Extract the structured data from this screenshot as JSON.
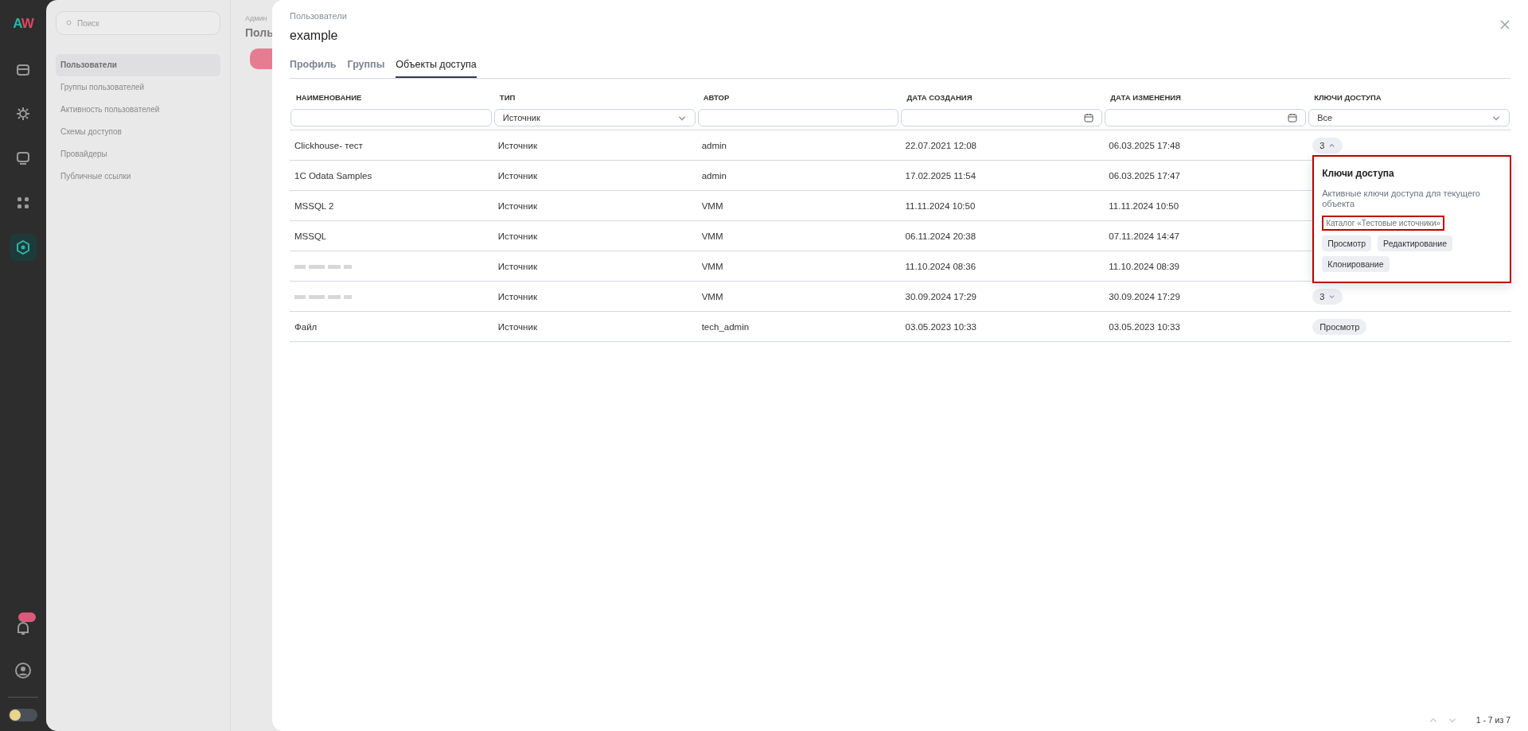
{
  "rail": {
    "logo": [
      {
        "text": "A",
        "color": "#2bb5a8"
      },
      {
        "text": "W",
        "color": "#e0455e"
      }
    ],
    "items": [
      {
        "selected": false
      },
      {
        "selected": false
      },
      {
        "selected": false
      },
      {
        "selected": false
      },
      {
        "selected": true
      }
    ],
    "theme_toggle": {
      "on": false
    }
  },
  "nav": {
    "search": {
      "placeholder": "Поиск"
    },
    "items": [
      {
        "label": "Пользователи",
        "selected": true
      },
      {
        "label": "Группы пользователей",
        "selected": false
      },
      {
        "label": "Активность пользователей",
        "selected": false
      },
      {
        "label": "Схемы доступов",
        "selected": false
      },
      {
        "label": "Провайдеры",
        "selected": false
      },
      {
        "label": "Публичные ссылки",
        "selected": false
      }
    ]
  },
  "page": {
    "breadcrumb": "Админ",
    "title": "Поль"
  },
  "drawer": {
    "breadcrumb": "Пользователи",
    "title": "example",
    "tabs": [
      {
        "label": "Профиль",
        "selected": false
      },
      {
        "label": "Группы",
        "selected": false
      },
      {
        "label": "Объекты доступа",
        "selected": true
      }
    ],
    "columns": [
      {
        "label": "НАИМЕНОВАНИЕ",
        "filter": {
          "kind": "text"
        }
      },
      {
        "label": "ТИП",
        "filter": {
          "kind": "select",
          "value": "Источник"
        }
      },
      {
        "label": "АВТОР",
        "filter": {
          "kind": "text"
        }
      },
      {
        "label": "ДАТА СОЗДАНИЯ",
        "filter": {
          "kind": "date"
        }
      },
      {
        "label": "ДАТА ИЗМЕНЕНИЯ",
        "filter": {
          "kind": "date"
        }
      },
      {
        "label": "КЛЮЧИ ДОСТУПА",
        "filter": {
          "kind": "select",
          "value": "Все"
        }
      }
    ],
    "rows": [
      {
        "name": "Clickhouse- тест",
        "type": "Источник",
        "author": "admin",
        "created": "22.07.2021 12:08",
        "modified": "06.03.2025 17:48",
        "keys": {
          "kind": "count",
          "value": "3",
          "expanded": true
        }
      },
      {
        "name": "1C Odata Samples",
        "type": "Источник",
        "author": "admin",
        "created": "17.02.2025 11:54",
        "modified": "06.03.2025 17:47"
      },
      {
        "name": "MSSQL 2",
        "type": "Источник",
        "author": "VMM",
        "created": "11.11.2024 10:50",
        "modified": "11.11.2024 10:50"
      },
      {
        "name": "MSSQL",
        "type": "Источник",
        "author": "VMM",
        "created": "06.11.2024 20:38",
        "modified": "07.11.2024 14:47"
      },
      {
        "redacted": true,
        "type": "Источник",
        "author": "VMM",
        "created": "11.10.2024 08:36",
        "modified": "11.10.2024 08:39"
      },
      {
        "redacted": true,
        "type": "Источник",
        "author": "VMM",
        "created": "30.09.2024 17:29",
        "modified": "30.09.2024 17:29",
        "keys": {
          "kind": "count",
          "value": "3",
          "expanded": false
        }
      },
      {
        "name": "Файл",
        "type": "Источник",
        "author": "tech_admin",
        "created": "03.05.2023 10:33",
        "modified": "03.05.2023 10:33",
        "keys": {
          "kind": "tags",
          "tags": [
            "Просмотр"
          ]
        }
      }
    ],
    "popover": {
      "highlighted": true,
      "title": "Ключи доступа",
      "description": "Активные ключи доступа для текущего объекта",
      "group": "Каталог «Тестовые источники»",
      "group_highlighted": true,
      "permissions": [
        "Просмотр",
        "Редактирование",
        "Клонирование"
      ]
    },
    "pagination": "1 - 7 из 7"
  }
}
